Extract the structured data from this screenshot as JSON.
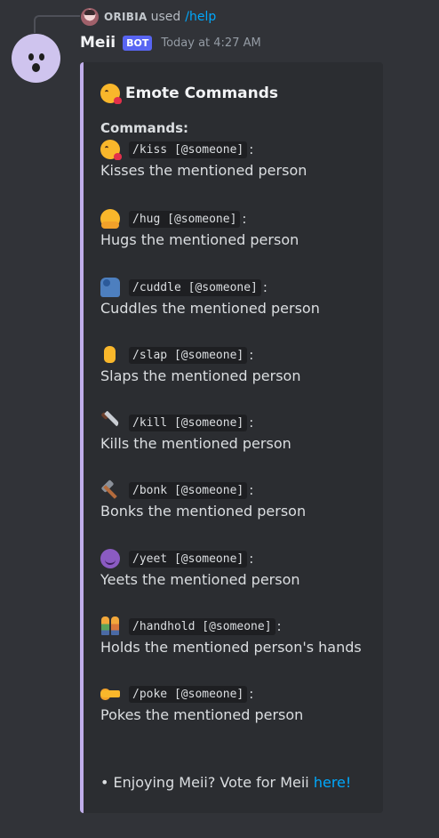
{
  "reply": {
    "username": "ORIBIA",
    "used_text": "used",
    "command": "/help"
  },
  "message": {
    "username": "Meii",
    "bot_tag": "BOT",
    "timestamp": "Today at 4:27 AM"
  },
  "embed": {
    "accent_color": "#c0aeea",
    "title": "Emote Commands",
    "title_icon": "kissing-heart-emoji",
    "commands_heading": "Commands:",
    "commands": [
      {
        "icon": "kissing-heart-emoji",
        "code": "/kiss [@someone]",
        "desc": "Kisses the mentioned person"
      },
      {
        "icon": "hugging-face-emoji",
        "code": "/hug [@someone]",
        "desc": "Hugs the mentioned person"
      },
      {
        "icon": "people-hugging-emoji",
        "code": "/cuddle [@someone]",
        "desc": "Cuddles the mentioned person"
      },
      {
        "icon": "raised-hand-emoji",
        "code": "/slap [@someone]",
        "desc": "Slaps the mentioned person"
      },
      {
        "icon": "knife-emoji",
        "code": "/kill [@someone]",
        "desc": "Kills the mentioned person"
      },
      {
        "icon": "hammer-emoji",
        "code": "/bonk [@someone]",
        "desc": "Bonks the mentioned person"
      },
      {
        "icon": "smiling-devil-emoji",
        "code": "/yeet [@someone]",
        "desc": "Yeets the mentioned person"
      },
      {
        "icon": "holding-hands-emoji",
        "code": "/handhold [@someone]",
        "desc": "Holds the mentioned person's hands"
      },
      {
        "icon": "pointing-right-emoji",
        "code": "/poke [@someone]",
        "desc": "Pokes the mentioned person"
      }
    ],
    "footer_text": "• Enjoying Meii? Vote for Meii",
    "footer_link": "here!"
  }
}
